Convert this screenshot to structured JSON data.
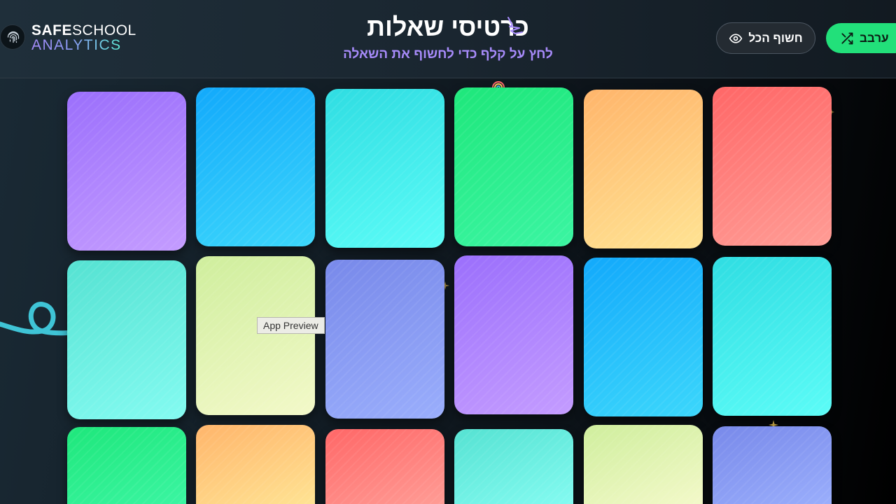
{
  "brand": {
    "line1_bold": "SAFE",
    "line1_regular": "SCHOOL",
    "line2": "ANALYTICS"
  },
  "header": {
    "title": "כרטיסי שאלות",
    "subtitle": "לחץ על קלף כדי לחשוף את השאלה",
    "reveal_all_label": "חשוף הכל",
    "shuffle_label": "ערבב"
  },
  "tooltip": "App Preview",
  "icons": {
    "logo": "fingerprint-icon",
    "reveal": "eye-icon",
    "shuffle": "shuffle-icon",
    "title_decoration": "sparkle-icon"
  },
  "colors": {
    "accent_green": "#22e07a",
    "accent_purple": "#a78bfa",
    "card_gradients": [
      "purple",
      "blue",
      "cyan",
      "green",
      "orange",
      "red",
      "teal",
      "lime",
      "indigo"
    ]
  },
  "cards": {
    "count_visible": 18,
    "face_down": true
  }
}
